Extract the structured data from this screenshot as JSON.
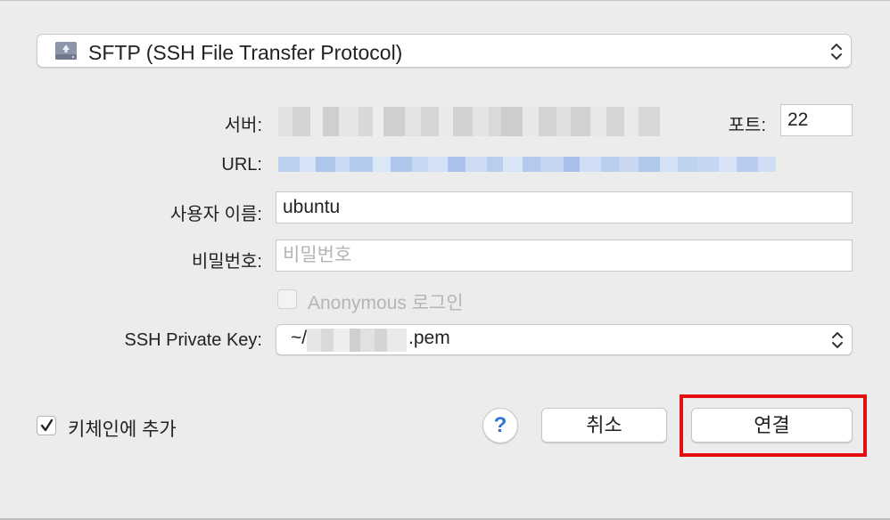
{
  "protocol": {
    "label": "SFTP (SSH File Transfer Protocol)"
  },
  "form": {
    "server_label": "서버:",
    "port_label": "포트:",
    "port_value": "22",
    "url_label": "URL:",
    "username_label": "사용자 이름:",
    "username_value": "ubuntu",
    "password_label": "비밀번호:",
    "password_placeholder": "비밀번호",
    "anonymous_label": "Anonymous 로그인",
    "ssh_key_label": "SSH Private Key:",
    "ssh_key_prefix": "~/",
    "ssh_key_suffix": ".pem"
  },
  "footer": {
    "keychain_label": "키체인에 추가",
    "keychain_checked": true,
    "help_label": "?",
    "cancel_label": "취소",
    "connect_label": "연결"
  },
  "colors": {
    "highlight": "#e41010",
    "accent": "#2e74d8"
  }
}
